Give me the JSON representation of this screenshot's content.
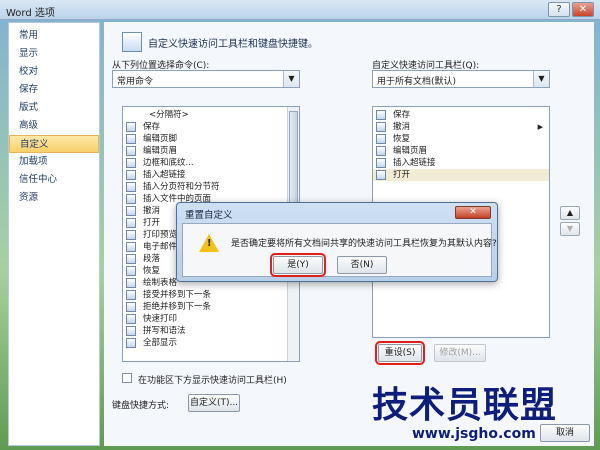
{
  "window": {
    "title": "Word 选项",
    "help_label": "?",
    "close_label": "✕"
  },
  "nav": {
    "items": [
      {
        "label": "常用"
      },
      {
        "label": "显示"
      },
      {
        "label": "校对"
      },
      {
        "label": "保存"
      },
      {
        "label": "版式"
      },
      {
        "label": "高级"
      },
      {
        "label": "自定义"
      },
      {
        "label": "加载项"
      },
      {
        "label": "信任中心"
      },
      {
        "label": "资源"
      }
    ],
    "active": "自定义"
  },
  "header": {
    "title": "自定义快速访问工具栏和键盘快捷键。"
  },
  "left": {
    "choose_label": "从下列位置选择命令(C):",
    "choose_value": "常用命令",
    "commands": [
      {
        "label": "<分隔符>",
        "icon": "separator-icon"
      },
      {
        "label": "保存",
        "icon": "save-icon"
      },
      {
        "label": "编辑页脚",
        "icon": "footer-icon"
      },
      {
        "label": "编辑页眉",
        "icon": "header-icon"
      },
      {
        "label": "边框和底纹...",
        "icon": "border-icon"
      },
      {
        "label": "插入超链接",
        "icon": "hyperlink-icon"
      },
      {
        "label": "插入分页符和分节符",
        "icon": "break-icon",
        "submenu": true
      },
      {
        "label": "插入文件中的页面",
        "icon": "insert-file-icon"
      },
      {
        "label": "撤消",
        "icon": "undo-icon",
        "submenu": true
      },
      {
        "label": "打开",
        "icon": "open-icon"
      },
      {
        "label": "打印预览",
        "icon": "print-preview-icon"
      },
      {
        "label": "电子邮件",
        "icon": "email-icon"
      },
      {
        "label": "段落",
        "icon": "paragraph-icon"
      },
      {
        "label": "恢复",
        "icon": "redo-icon"
      },
      {
        "label": "绘制表格",
        "icon": "draw-table-icon"
      },
      {
        "label": "接受并移到下一条",
        "icon": "accept-icon"
      },
      {
        "label": "拒绝并移到下一条",
        "icon": "reject-icon"
      },
      {
        "label": "快速打印",
        "icon": "quick-print-icon"
      },
      {
        "label": "拼写和语法",
        "icon": "spelling-icon"
      },
      {
        "label": "全部显示",
        "icon": "show-all-icon"
      }
    ],
    "show_below_label": "在功能区下方显示快速访问工具栏(H)",
    "shortcut_label": "键盘快捷方式:",
    "customize_button": "自定义(T)..."
  },
  "right": {
    "qat_label": "自定义快速访问工具栏(Q):",
    "qat_value": "用于所有文档(默认)",
    "items": [
      {
        "label": "保存",
        "icon": "save-icon"
      },
      {
        "label": "撤消",
        "icon": "undo-icon",
        "submenu": true
      },
      {
        "label": "恢复",
        "icon": "redo-icon"
      },
      {
        "label": "编辑页眉",
        "icon": "header-icon"
      },
      {
        "label": "插入超链接",
        "icon": "hyperlink-icon"
      },
      {
        "label": "打开",
        "icon": "open-icon"
      }
    ],
    "reset_button": "重设(S)",
    "modify_button": "修改(M)...",
    "move_up": "▲",
    "move_down": "▼",
    "cancel_button": "取消"
  },
  "dialog": {
    "title": "重置自定义",
    "close_label": "✕",
    "message": "是否确定要将所有文档间共享的快速访问工具栏恢复为其默认内容?",
    "yes_button": "是(Y)",
    "no_button": "否(N)"
  },
  "watermark": {
    "line1": "技术员联盟",
    "line2": "www.jsgho.com"
  }
}
